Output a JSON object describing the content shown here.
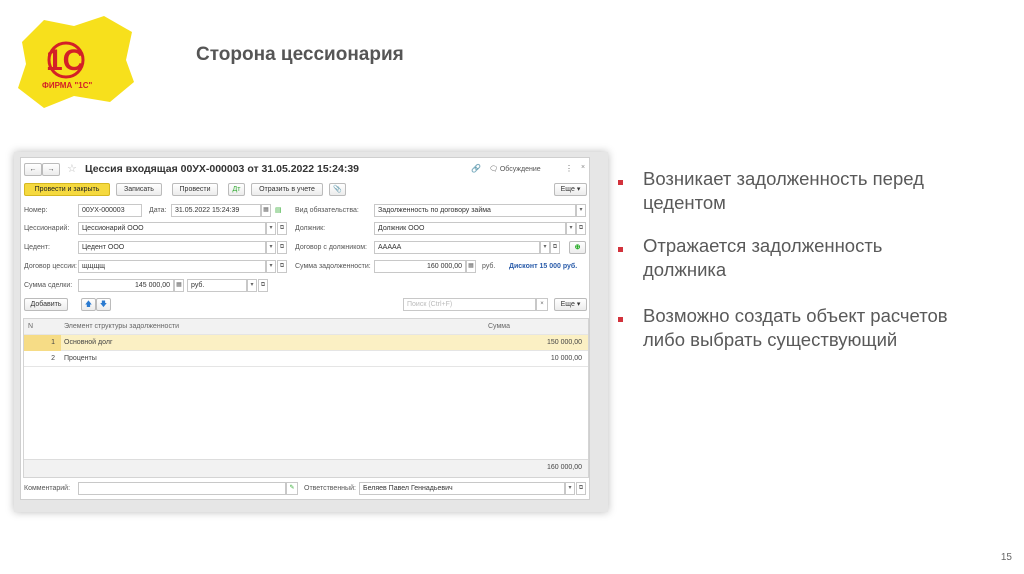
{
  "slide": {
    "title": "Сторона цессионария",
    "page_number": "15",
    "logo_text": "ФИРМА \"1С\""
  },
  "bullets": [
    {
      "line1": "Возникает задолженность перед",
      "line2": "цедентом"
    },
    {
      "line1": "Отражается задолженность",
      "line2": "должника"
    },
    {
      "line1": "Возможно создать объект расчетов",
      "line2": "либо выбрать существующий"
    }
  ],
  "window": {
    "title": "Цессия входящая 00УХ-000003 от 31.05.2022 15:24:39",
    "discussion": "Обсуждение",
    "toolbar": {
      "post_close": "Провести и закрыть",
      "save": "Записать",
      "post": "Провести",
      "reflect": "Отразить в учете",
      "more": "Еще ▾"
    },
    "fields": {
      "number_label": "Номер:",
      "number": "00УХ-000003",
      "date_label": "Дата:",
      "date": "31.05.2022 15:24:39",
      "assignee_label": "Цессионарий:",
      "assignee": "Цессионарий ООО",
      "assignor_label": "Цедент:",
      "assignor": "Цедент ООО",
      "contract_label": "Договор цессии:",
      "contract": "щщщщ",
      "deal_sum_label": "Сумма сделки:",
      "deal_sum": "145 000,00",
      "currency": "руб.",
      "obligation_label": "Вид обязательства:",
      "obligation": "Задолженность по договору займа",
      "debtor_label": "Должник:",
      "debtor": "Должник ООО",
      "debtor_contract_label": "Договор с должником:",
      "debtor_contract": "ААААА",
      "debt_sum_label": "Сумма задолженности:",
      "debt_sum": "160 000,00",
      "debt_currency": "руб.",
      "discount": "Дисконт 15 000 руб."
    },
    "table_toolbar": {
      "add": "Добавить",
      "search_placeholder": "Поиск (Ctrl+F)",
      "more": "Еще ▾"
    },
    "table": {
      "headers": [
        "N",
        "Элемент структуры задолженности",
        "Сумма"
      ],
      "rows": [
        [
          "1",
          "Основной долг",
          "150 000,00"
        ],
        [
          "2",
          "Проценты",
          "10 000,00"
        ]
      ],
      "total": "160 000,00"
    },
    "footer": {
      "comment_label": "Комментарий:",
      "comment": "",
      "responsible_label": "Ответственный:",
      "responsible": "Беляев Павел Геннадьевич"
    }
  }
}
